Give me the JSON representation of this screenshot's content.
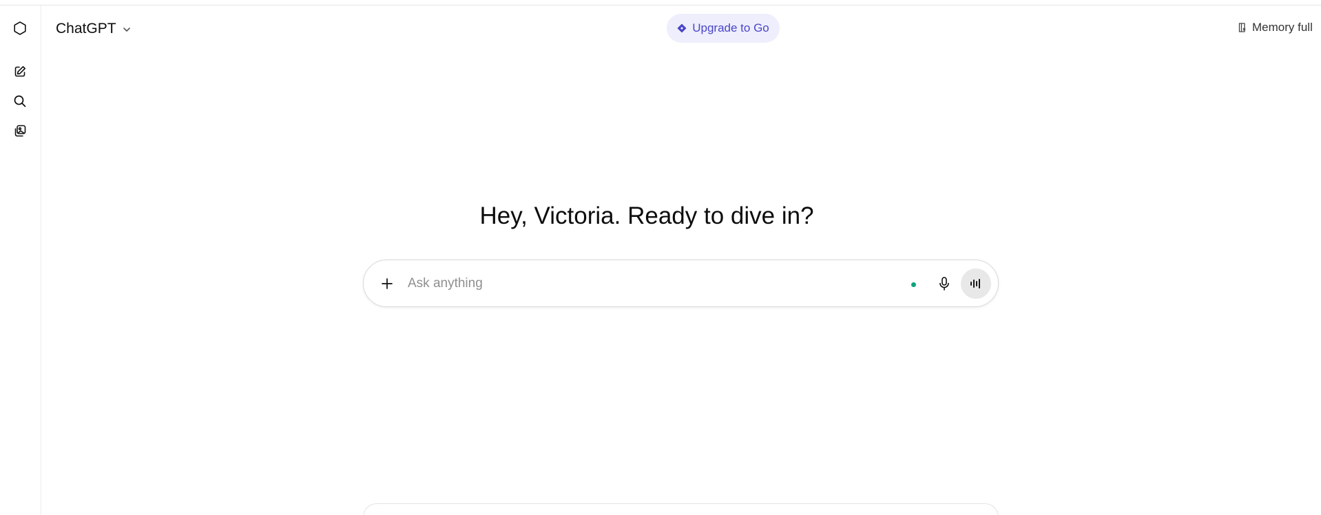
{
  "header": {
    "model_label": "ChatGPT",
    "upgrade_label": "Upgrade to Go",
    "memory_label": "Memory full"
  },
  "sidebar": {
    "items": [
      {
        "name": "openai-logo-icon"
      },
      {
        "name": "new-chat-icon"
      },
      {
        "name": "search-icon"
      },
      {
        "name": "library-icon"
      }
    ]
  },
  "main": {
    "greeting": "Hey, Victoria. Ready to dive in?"
  },
  "composer": {
    "placeholder": "Ask anything"
  },
  "colors": {
    "accent": "#4a45c9",
    "upgrade_bg": "#eeeefc",
    "status_dot": "#10a37f"
  }
}
